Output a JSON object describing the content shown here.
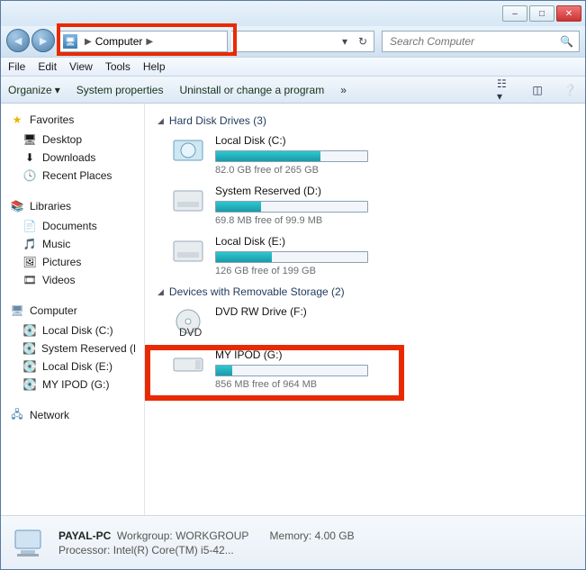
{
  "titlebar": {
    "min": "–",
    "max": "□",
    "close": "✕"
  },
  "breadcrumb": {
    "location": "Computer"
  },
  "search": {
    "placeholder": "Search Computer"
  },
  "menubar": [
    "File",
    "Edit",
    "View",
    "Tools",
    "Help"
  ],
  "toolbar": {
    "organize": "Organize",
    "sysprops": "System properties",
    "uninstall": "Uninstall or change a program",
    "more": "»"
  },
  "sidebar": {
    "favorites": {
      "label": "Favorites",
      "items": [
        "Desktop",
        "Downloads",
        "Recent Places"
      ]
    },
    "libraries": {
      "label": "Libraries",
      "items": [
        "Documents",
        "Music",
        "Pictures",
        "Videos"
      ]
    },
    "computer": {
      "label": "Computer",
      "items": [
        "Local Disk (C:)",
        "System Reserved (D:)",
        "Local Disk (E:)",
        "MY IPOD (G:)"
      ]
    },
    "network": {
      "label": "Network"
    }
  },
  "main": {
    "hdd": {
      "title": "Hard Disk Drives (3)",
      "drives": [
        {
          "name": "Local Disk (C:)",
          "free": "82.0 GB free of 265 GB",
          "pct": 69
        },
        {
          "name": "System Reserved (D:)",
          "free": "69.8 MB free of 99.9 MB",
          "pct": 30
        },
        {
          "name": "Local Disk (E:)",
          "free": "126 GB free of 199 GB",
          "pct": 37
        }
      ]
    },
    "removable": {
      "title": "Devices with Removable Storage (2)",
      "drives": [
        {
          "name": "DVD RW Drive (F:)",
          "free": "",
          "pct": null
        },
        {
          "name": "MY IPOD (G:)",
          "free": "856 MB free of 964 MB",
          "pct": 11
        }
      ]
    }
  },
  "details": {
    "name": "PAYAL-PC",
    "workgroup_label": "Workgroup:",
    "workgroup": "WORKGROUP",
    "memory_label": "Memory:",
    "memory": "4.00 GB",
    "processor_label": "Processor:",
    "processor": "Intel(R) Core(TM) i5-42..."
  },
  "highlight_colors": {
    "red": "#e92a00"
  }
}
